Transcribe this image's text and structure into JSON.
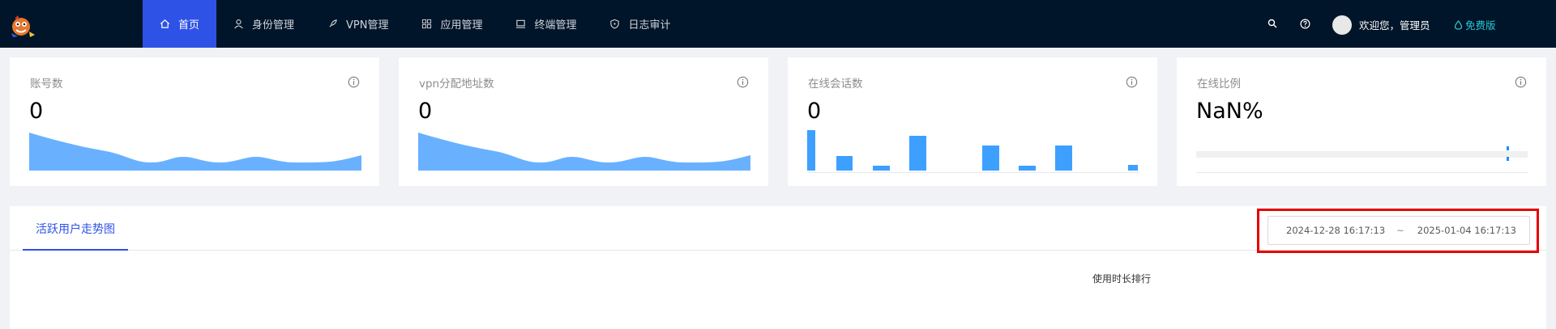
{
  "nav": {
    "items": [
      {
        "label": "首页",
        "icon": "home-icon",
        "active": true
      },
      {
        "label": "身份管理",
        "icon": "user-icon",
        "active": false
      },
      {
        "label": "VPN管理",
        "icon": "rocket-icon",
        "active": false
      },
      {
        "label": "应用管理",
        "icon": "apps-icon",
        "active": false
      },
      {
        "label": "终端管理",
        "icon": "laptop-icon",
        "active": false
      },
      {
        "label": "日志审计",
        "icon": "shield-icon",
        "active": false
      }
    ]
  },
  "header": {
    "welcome": "欢迎您，管理员",
    "edition": "免费版"
  },
  "stats": [
    {
      "title": "账号数",
      "value": "0"
    },
    {
      "title": "vpn分配地址数",
      "value": "0"
    },
    {
      "title": "在线会话数",
      "value": "0"
    },
    {
      "title": "在线比例",
      "value": "NaN%"
    }
  ],
  "main": {
    "tab_label": "活跃用户走势图",
    "date_start": "2024-12-28 16:17:13",
    "date_sep": "~",
    "date_end": "2025-01-04 16:17:13",
    "chart_title": "使用时长排行"
  },
  "colors": {
    "nav_bg": "#001529",
    "accent": "#2e52e6",
    "area_fill": "#69b1ff",
    "bar_fill": "#3da0ff",
    "edition": "#25c9d6",
    "highlight": "#e60000"
  }
}
